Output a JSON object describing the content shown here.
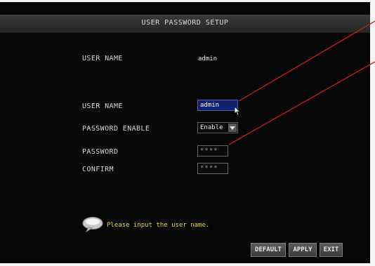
{
  "window": {
    "title": "USER PASSWORD SETUP"
  },
  "current_user": {
    "label": "USER NAME",
    "value": "admin"
  },
  "form": {
    "user_name": {
      "label": "USER NAME",
      "value": "admin"
    },
    "password_enable": {
      "label": "PASSWORD ENABLE",
      "value": "Enable"
    },
    "password": {
      "label": "PASSWORD",
      "value": "****"
    },
    "confirm": {
      "label": "CONFIRM",
      "value": "****"
    }
  },
  "hint": {
    "text": "Please input the user name.",
    "icon": "speech-bubble-icon"
  },
  "buttons": {
    "default": "DEFAULT",
    "apply": "APPLY",
    "exit": "EXIT"
  },
  "colors": {
    "background": "#070707",
    "selected_field": "#10216e",
    "hint_text": "#e9d92d",
    "annotation_line": "#cc1a1a"
  }
}
